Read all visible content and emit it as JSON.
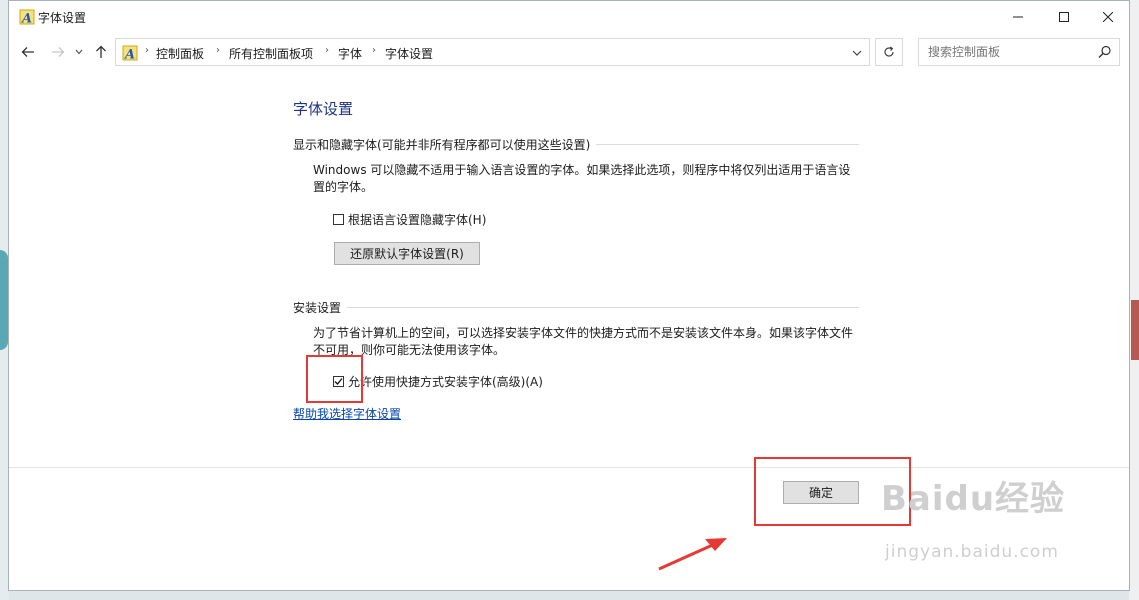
{
  "window": {
    "title": "字体设置"
  },
  "address_bar": {
    "crumbs": [
      "控制面板",
      "所有控制面板项",
      "字体",
      "字体设置"
    ]
  },
  "search": {
    "placeholder": "搜索控制面板"
  },
  "content": {
    "title": "字体设置",
    "section1": {
      "header": "显示和隐藏字体(可能并非所有程序都可以使用这些设置)",
      "description_line1": "Windows 可以隐藏不适用于输入语言设置的字体。如果选择此选项，则程序中将仅列出适用于语言设",
      "description_line2": "置的字体。",
      "checkbox_label": "根据语言设置隐藏字体(H)",
      "checkbox_checked": false,
      "restore_button": "还原默认字体设置(R)"
    },
    "section2": {
      "header": "安装设置",
      "description_line1": "为了节省计算机上的空间，可以选择安装字体文件的快捷方式而不是安装该文件本身。如果该字体文件",
      "description_line2": "不可用，则你可能无法使用该字体。",
      "checkbox_label": "允许使用快捷方式安装字体(高级)(A)",
      "checkbox_checked": true
    },
    "help_link": "帮助我选择字体设置"
  },
  "footer": {
    "ok_button": "确定"
  },
  "watermark": {
    "brand": "Baidu经验",
    "url": "jingyan.baidu.com"
  },
  "colors": {
    "title_blue": "#1e3287",
    "link_blue": "#0645ad",
    "annotation_red": "#e53935"
  }
}
